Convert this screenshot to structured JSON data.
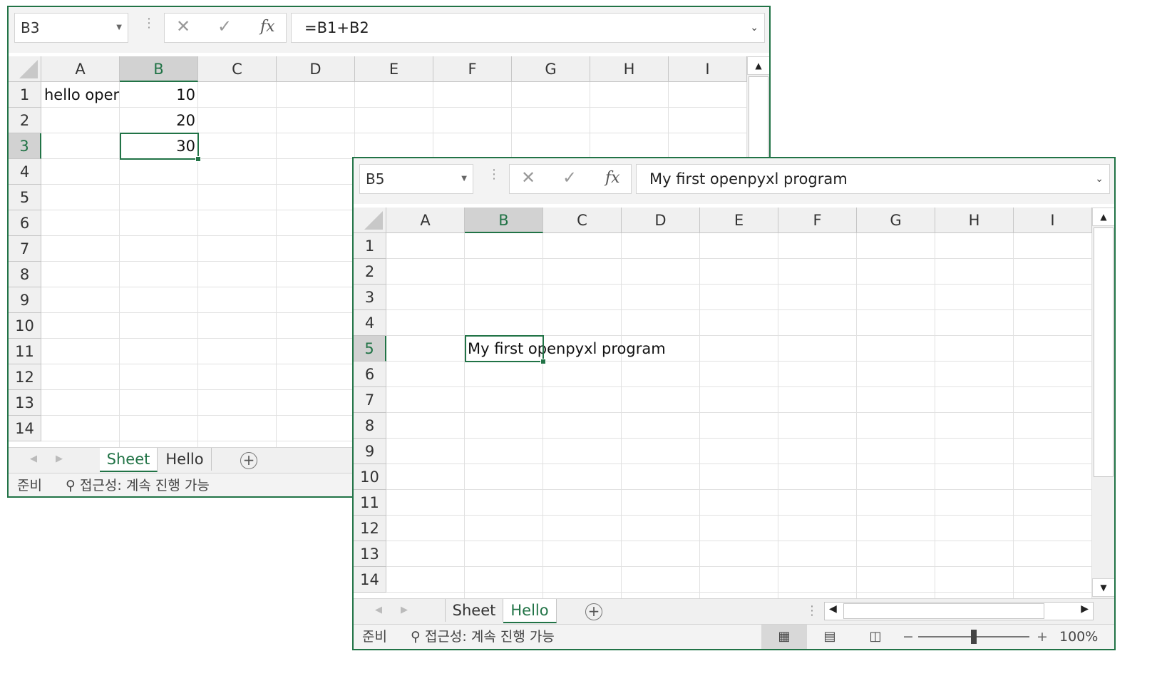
{
  "colors": {
    "accent": "#217346",
    "gridline": "#e1e1e1",
    "header_bg": "#f0f0f0"
  },
  "window1": {
    "name_box": "B3",
    "formula": "=B1+B2",
    "columns": [
      "A",
      "B",
      "C",
      "D",
      "E",
      "F",
      "G",
      "H",
      "I"
    ],
    "rows": [
      "1",
      "2",
      "3",
      "4",
      "5",
      "6",
      "7",
      "8",
      "9",
      "10",
      "11",
      "12",
      "13",
      "14"
    ],
    "cells": {
      "A1": "hello oper",
      "B1": "10",
      "B2": "20",
      "B3": "30"
    },
    "selected_column": "B",
    "selected_row": "3",
    "tabs": [
      "Sheet",
      "Hello"
    ],
    "active_tab": "Sheet",
    "status_ready": "준비",
    "accessibility": "접근성: 계속 진행 가능"
  },
  "window2": {
    "name_box": "B5",
    "formula": "My first openpyxl program",
    "columns": [
      "A",
      "B",
      "C",
      "D",
      "E",
      "F",
      "G",
      "H",
      "I"
    ],
    "rows": [
      "1",
      "2",
      "3",
      "4",
      "5",
      "6",
      "7",
      "8",
      "9",
      "10",
      "11",
      "12",
      "13",
      "14"
    ],
    "cells": {
      "B5": "My first openpyxl program"
    },
    "selected_column": "B",
    "selected_row": "5",
    "tabs": [
      "Sheet",
      "Hello"
    ],
    "active_tab": "Hello",
    "status_ready": "준비",
    "accessibility": "접근성: 계속 진행 가능",
    "zoom": "100%",
    "zoom_minus": "−",
    "zoom_plus": "+"
  },
  "icons": {
    "cancel": "✕",
    "enter": "✓",
    "function": "fx",
    "dropdown": "▾",
    "add_sheet": "+",
    "accessibility": "accessibility-icon"
  }
}
